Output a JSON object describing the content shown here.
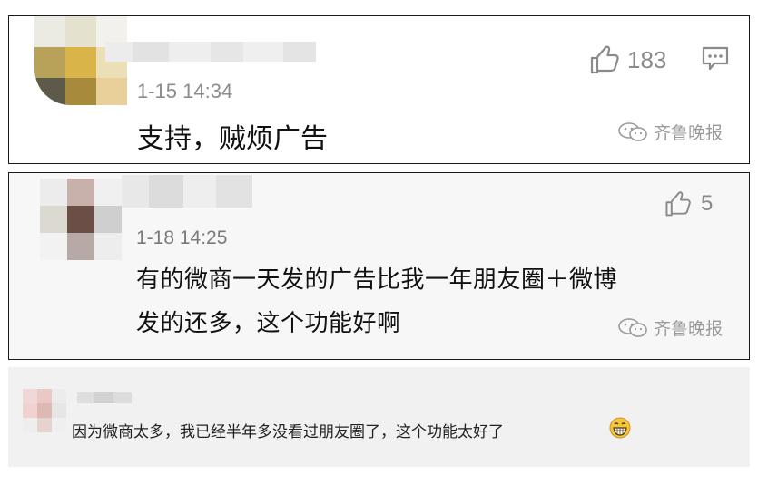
{
  "comments": [
    {
      "time": "1-15 14:34",
      "text": "支持，贼烦广告",
      "likes": "183",
      "watermark": "齐鲁晚报",
      "icons": [
        "thumbs-up-icon",
        "reply-icon",
        "wechat-icon"
      ]
    },
    {
      "name_partial": "泥字",
      "time": "1-18 14:25",
      "text_line1": "有的微商一天发的广告比我一年朋友圈＋微博",
      "text_line2": "发的还多，这个功能好啊",
      "likes": "5",
      "watermark": "齐鲁晚报",
      "icons": [
        "thumbs-up-icon",
        "wechat-icon"
      ]
    },
    {
      "text": "因为微商太多，我已经半年多没看过朋友圈了，这个功能太好了",
      "icons": [
        "grin-emoji-icon"
      ]
    }
  ],
  "colors": {
    "text": "#111111",
    "meta": "#8c8c8c",
    "card2_bg": "#f7f7f7",
    "card3_bg": "#f1f1f1",
    "border": "#1a1a1a"
  }
}
